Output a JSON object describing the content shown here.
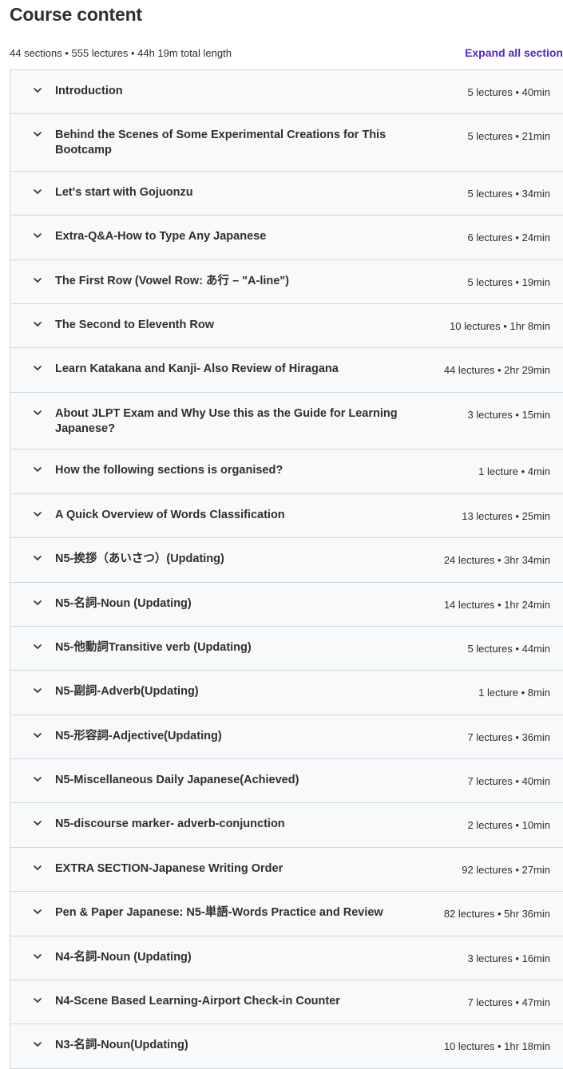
{
  "header": {
    "title": "Course content",
    "summary": "44 sections • 555 lectures • 44h 19m total length",
    "expand_all_label": "Expand all section"
  },
  "sections": [
    {
      "title": "Introduction",
      "meta": "5 lectures • 40min",
      "tall": false
    },
    {
      "title": "Behind the Scenes of Some Experimental Creations for This Bootcamp",
      "meta": "5 lectures • 21min",
      "tall": true
    },
    {
      "title": "Let's start with Gojuonzu",
      "meta": "5 lectures • 34min",
      "tall": false
    },
    {
      "title": "Extra-Q&A-How to Type Any Japanese",
      "meta": "6 lectures • 24min",
      "tall": false
    },
    {
      "title": "The First Row (Vowel Row: あ行 – \"A-line\")",
      "meta": "5 lectures • 19min",
      "tall": false
    },
    {
      "title": "The Second to Eleventh Row",
      "meta": "10 lectures • 1hr 8min",
      "tall": false
    },
    {
      "title": "Learn Katakana and Kanji- Also Review of Hiragana",
      "meta": "44 lectures • 2hr 29min",
      "tall": false
    },
    {
      "title": "About JLPT Exam and Why Use this as the Guide for Learning Japanese?",
      "meta": "3 lectures • 15min",
      "tall": true
    },
    {
      "title": "How the following sections is organised?",
      "meta": "1 lecture • 4min",
      "tall": false
    },
    {
      "title": "A Quick Overview of Words Classification",
      "meta": "13 lectures • 25min",
      "tall": false
    },
    {
      "title": "N5-挨拶（あいさつ）(Updating)",
      "meta": "24 lectures • 3hr 34min",
      "tall": false
    },
    {
      "title": "N5-名詞-Noun (Updating)",
      "meta": "14 lectures • 1hr 24min",
      "tall": false
    },
    {
      "title": "N5-他動詞Transitive verb (Updating)",
      "meta": "5 lectures • 44min",
      "tall": false
    },
    {
      "title": "N5-副詞-Adverb(Updating)",
      "meta": "1 lecture • 8min",
      "tall": false
    },
    {
      "title": "N5-形容詞-Adjective(Updating)",
      "meta": "7 lectures • 36min",
      "tall": false
    },
    {
      "title": "N5-Miscellaneous Daily Japanese(Achieved)",
      "meta": "7 lectures • 40min",
      "tall": false
    },
    {
      "title": "N5-discourse marker- adverb-conjunction",
      "meta": "2 lectures • 10min",
      "tall": false
    },
    {
      "title": "EXTRA SECTION-Japanese Writing Order",
      "meta": "92 lectures • 27min",
      "tall": false
    },
    {
      "title": "Pen & Paper Japanese: N5-単語-Words Practice and Review",
      "meta": "82 lectures • 5hr 36min",
      "tall": false
    },
    {
      "title": "N4-名詞-Noun (Updating)",
      "meta": "3 lectures • 16min",
      "tall": false
    },
    {
      "title": "N4-Scene Based Learning-Airport Check-in Counter",
      "meta": "7 lectures • 47min",
      "tall": false
    },
    {
      "title": "N3-名詞-Noun(Updating)",
      "meta": "10 lectures • 1hr 18min",
      "tall": false
    }
  ],
  "colors": {
    "accent": "#5624d0",
    "row_bg": "#f7f9fa",
    "border": "#d1d7dc",
    "text": "#2d2f31"
  },
  "icons": {
    "row_toggle": "chevron-down-icon"
  }
}
